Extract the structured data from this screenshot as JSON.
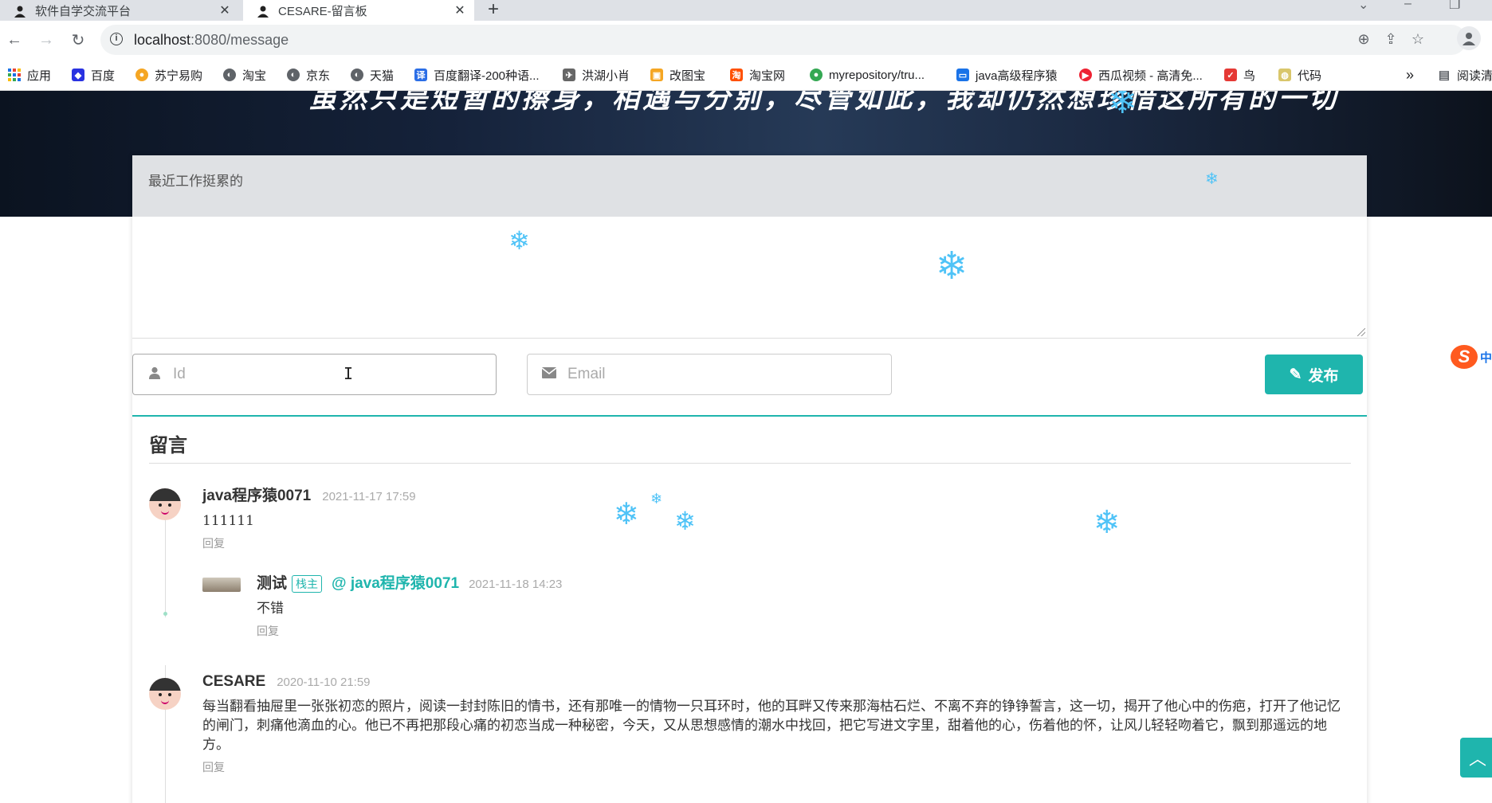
{
  "browser": {
    "tabs": [
      {
        "title": "软件自学交流平台",
        "active": false
      },
      {
        "title": "CESARE-留言板",
        "active": true
      }
    ],
    "new_tab_label": "+",
    "address": {
      "host": "localhost",
      "port_path": ":8080/message"
    },
    "bookmarks": [
      {
        "label": "应用",
        "icon": "apps-grid-icon",
        "color": "#1a73e8"
      },
      {
        "label": "百度",
        "icon": "baidu-paw-icon",
        "color": "#2932e1"
      },
      {
        "label": "苏宁易购",
        "icon": "suning-icon",
        "color": "#f5a623"
      },
      {
        "label": "淘宝",
        "icon": "globe-icon",
        "color": "#5f6368"
      },
      {
        "label": "京东",
        "icon": "globe-icon",
        "color": "#5f6368"
      },
      {
        "label": "天猫",
        "icon": "globe-icon",
        "color": "#5f6368"
      },
      {
        "label": "百度翻译-200种语...",
        "icon": "translate-icon",
        "color": "#2b6ee6"
      },
      {
        "label": "洪湖小肖",
        "icon": "bird-icon",
        "color": "#666666"
      },
      {
        "label": "改图宝",
        "icon": "folder-icon",
        "color": "#f5a623"
      },
      {
        "label": "淘宝网",
        "icon": "taobao-icon",
        "color": "#ff5000"
      },
      {
        "label": "myrepository/tru...",
        "icon": "chrome-icon",
        "color": "#34a853"
      },
      {
        "label": "java高级程序猿",
        "icon": "bilibili-icon",
        "color": "#1a73e8"
      },
      {
        "label": "西瓜视频 - 高清免...",
        "icon": "xigua-icon",
        "color": "#ee2233"
      },
      {
        "label": "鸟",
        "icon": "bird-red-icon",
        "color": "#e53935"
      },
      {
        "label": "代码",
        "icon": "leaf-icon",
        "color": "#d9c66b"
      }
    ],
    "bookmarks_more": "»",
    "reading_list": "阅读清"
  },
  "hero": {
    "text": "虽然只是短暂的擦身，相遇与分别，尽管如此，我却仍然想珍惜这所有的一切"
  },
  "form": {
    "message_text": "最近工作挺累的",
    "id_placeholder": "Id",
    "email_placeholder": "Email",
    "publish_label": "发布"
  },
  "ime": {
    "logo": "S",
    "mode": "中"
  },
  "messages": {
    "section_title": "留言",
    "reply_label": "回复",
    "items": [
      {
        "name": "java程序猿0071",
        "time": "2021-11-17 17:59",
        "text": "111111"
      },
      {
        "name": "测试",
        "badge": "栈主",
        "at": "@ java程序猿0071",
        "time": "2021-11-18 14:23",
        "text": "不错"
      },
      {
        "name": "CESARE",
        "time": "2020-11-10 21:59",
        "text": "每当翻看抽屉里一张张初恋的照片，阅读一封封陈旧的情书，还有那唯一的情物一只耳环时，他的耳畔又传来那海枯石烂、不离不弃的铮铮誓言，这一切，揭开了他心中的伤疤，打开了他记忆的闸门，刺痛他滴血的心。他已不再把那段心痛的初恋当成一种秘密，今天，又从思想感情的潮水中找回，把它写进文字里，甜着他的心，伤着他的怀，让风儿轻轻吻着它，飘到那遥远的地方。"
      }
    ]
  },
  "colors": {
    "accent": "#1fb5ad",
    "snow": "#4fc3f7"
  }
}
